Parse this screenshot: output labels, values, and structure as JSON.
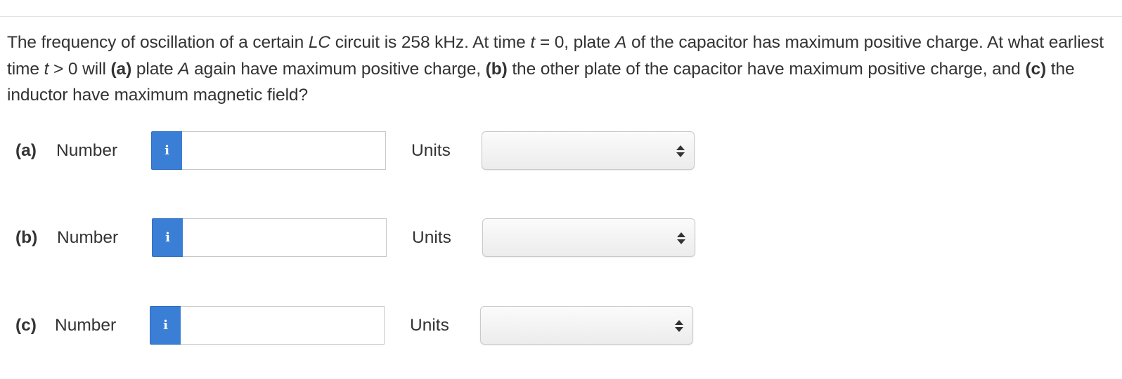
{
  "question": {
    "t1": "The frequency of oscillation of a certain ",
    "t2": "LC",
    "t3": " circuit is 258 kHz. At time ",
    "t4": "t",
    "t5": " = 0, plate ",
    "t6": "A",
    "t7": " of the capacitor has maximum positive charge. At what earliest time ",
    "t8": "t",
    "t9": " > 0 will ",
    "t10": "(a)",
    "t11": " plate ",
    "t12": "A",
    "t13": " again have maximum positive charge, ",
    "t14": "(b)",
    "t15": " the other plate of the capacitor have maximum positive charge, and ",
    "t16": "(c)",
    "t17": " the inductor have maximum magnetic field?"
  },
  "parts": [
    {
      "part_label": "(a)",
      "number_label": "Number",
      "info_icon": "i",
      "number_value": "",
      "units_label": "Units",
      "units_value": ""
    },
    {
      "part_label": "(b)",
      "number_label": "Number",
      "info_icon": "i",
      "number_value": "",
      "units_label": "Units",
      "units_value": ""
    },
    {
      "part_label": "(c)",
      "number_label": "Number",
      "info_icon": "i",
      "number_value": "",
      "units_label": "Units",
      "units_value": ""
    }
  ],
  "icons": {
    "info": "info-icon",
    "select_arrows": "updown-arrows-icon"
  },
  "colors": {
    "info_button": "#3a7fd5",
    "text": "#333333"
  }
}
